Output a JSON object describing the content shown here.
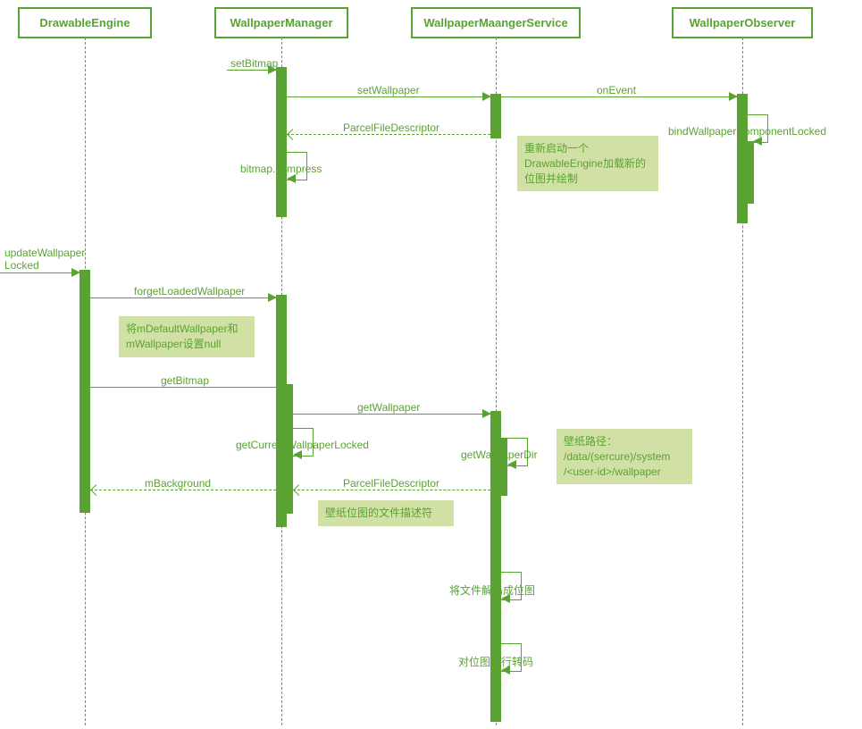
{
  "participants": {
    "p1": "DrawableEngine",
    "p2": "WallpaperManager",
    "p3": "WallpaperMaangerService",
    "p4": "WallpaperObserver"
  },
  "messages": {
    "setBitmap": "setBitmap",
    "setWallpaper": "setWallpaper",
    "onEvent": "onEvent",
    "bindWallpaperComponentLocked": "bindWallpaperComponentLocked",
    "parcelFileDescriptor": "ParcelFileDescriptor",
    "bitmapCompress": "bitmap.compress",
    "updateWallpaperLocked": "updateWallpaper",
    "updateWallpaperLocked2": "Locked",
    "forgetLoadedWallpaper": "forgetLoadedWallpaper",
    "getBitmap": "getBitmap",
    "getWallpaper": "getWallpaper",
    "getWallpaperDir": "getWallpaperDir",
    "getCurrentWallpaperLocked": "getCurrentWallpaperLocked",
    "mBackground": "mBackground",
    "decodeFile": "将文件解码成位图",
    "transcodeBitmap": "对位图进行转码"
  },
  "notes": {
    "restartEngine": "重新启动一个DrawableEngine加载新的位图并绘制",
    "setNull": "将mDefaultWallpaper和mWallpaper设置null",
    "wallpaperPath1": "壁纸路径：",
    "wallpaperPath2": "/data/(sercure)/system",
    "wallpaperPath3": "/<user-id>/wallpaper",
    "fileDescriptor": "壁纸位图的文件描述符"
  }
}
